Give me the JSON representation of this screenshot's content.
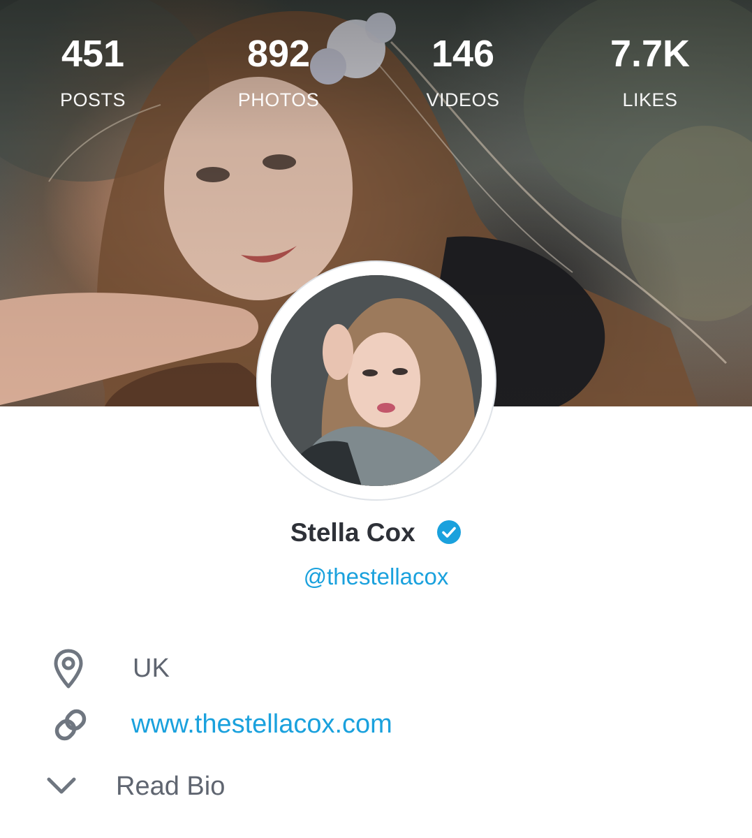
{
  "stats": [
    {
      "value": "451",
      "label": "POSTS"
    },
    {
      "value": "892",
      "label": "PHOTOS"
    },
    {
      "value": "146",
      "label": "VIDEOS"
    },
    {
      "value": "7.7K",
      "label": "LIKES"
    }
  ],
  "profile": {
    "name": "Stella Cox",
    "handle": "@thestellacox",
    "verified_icon": "verified-check-icon"
  },
  "info": {
    "location": "UK",
    "location_icon": "map-pin-icon",
    "website": "www.thestellacox.com",
    "website_icon": "link-icon",
    "bio_toggle": "Read Bio",
    "bio_icon": "chevron-down-icon"
  },
  "colors": {
    "accent": "#1aa1dd",
    "name_text": "#2e3138",
    "muted_text": "#5f6570",
    "icon_gray": "#6f7680",
    "avatar_ring": "#dfe3e8"
  }
}
